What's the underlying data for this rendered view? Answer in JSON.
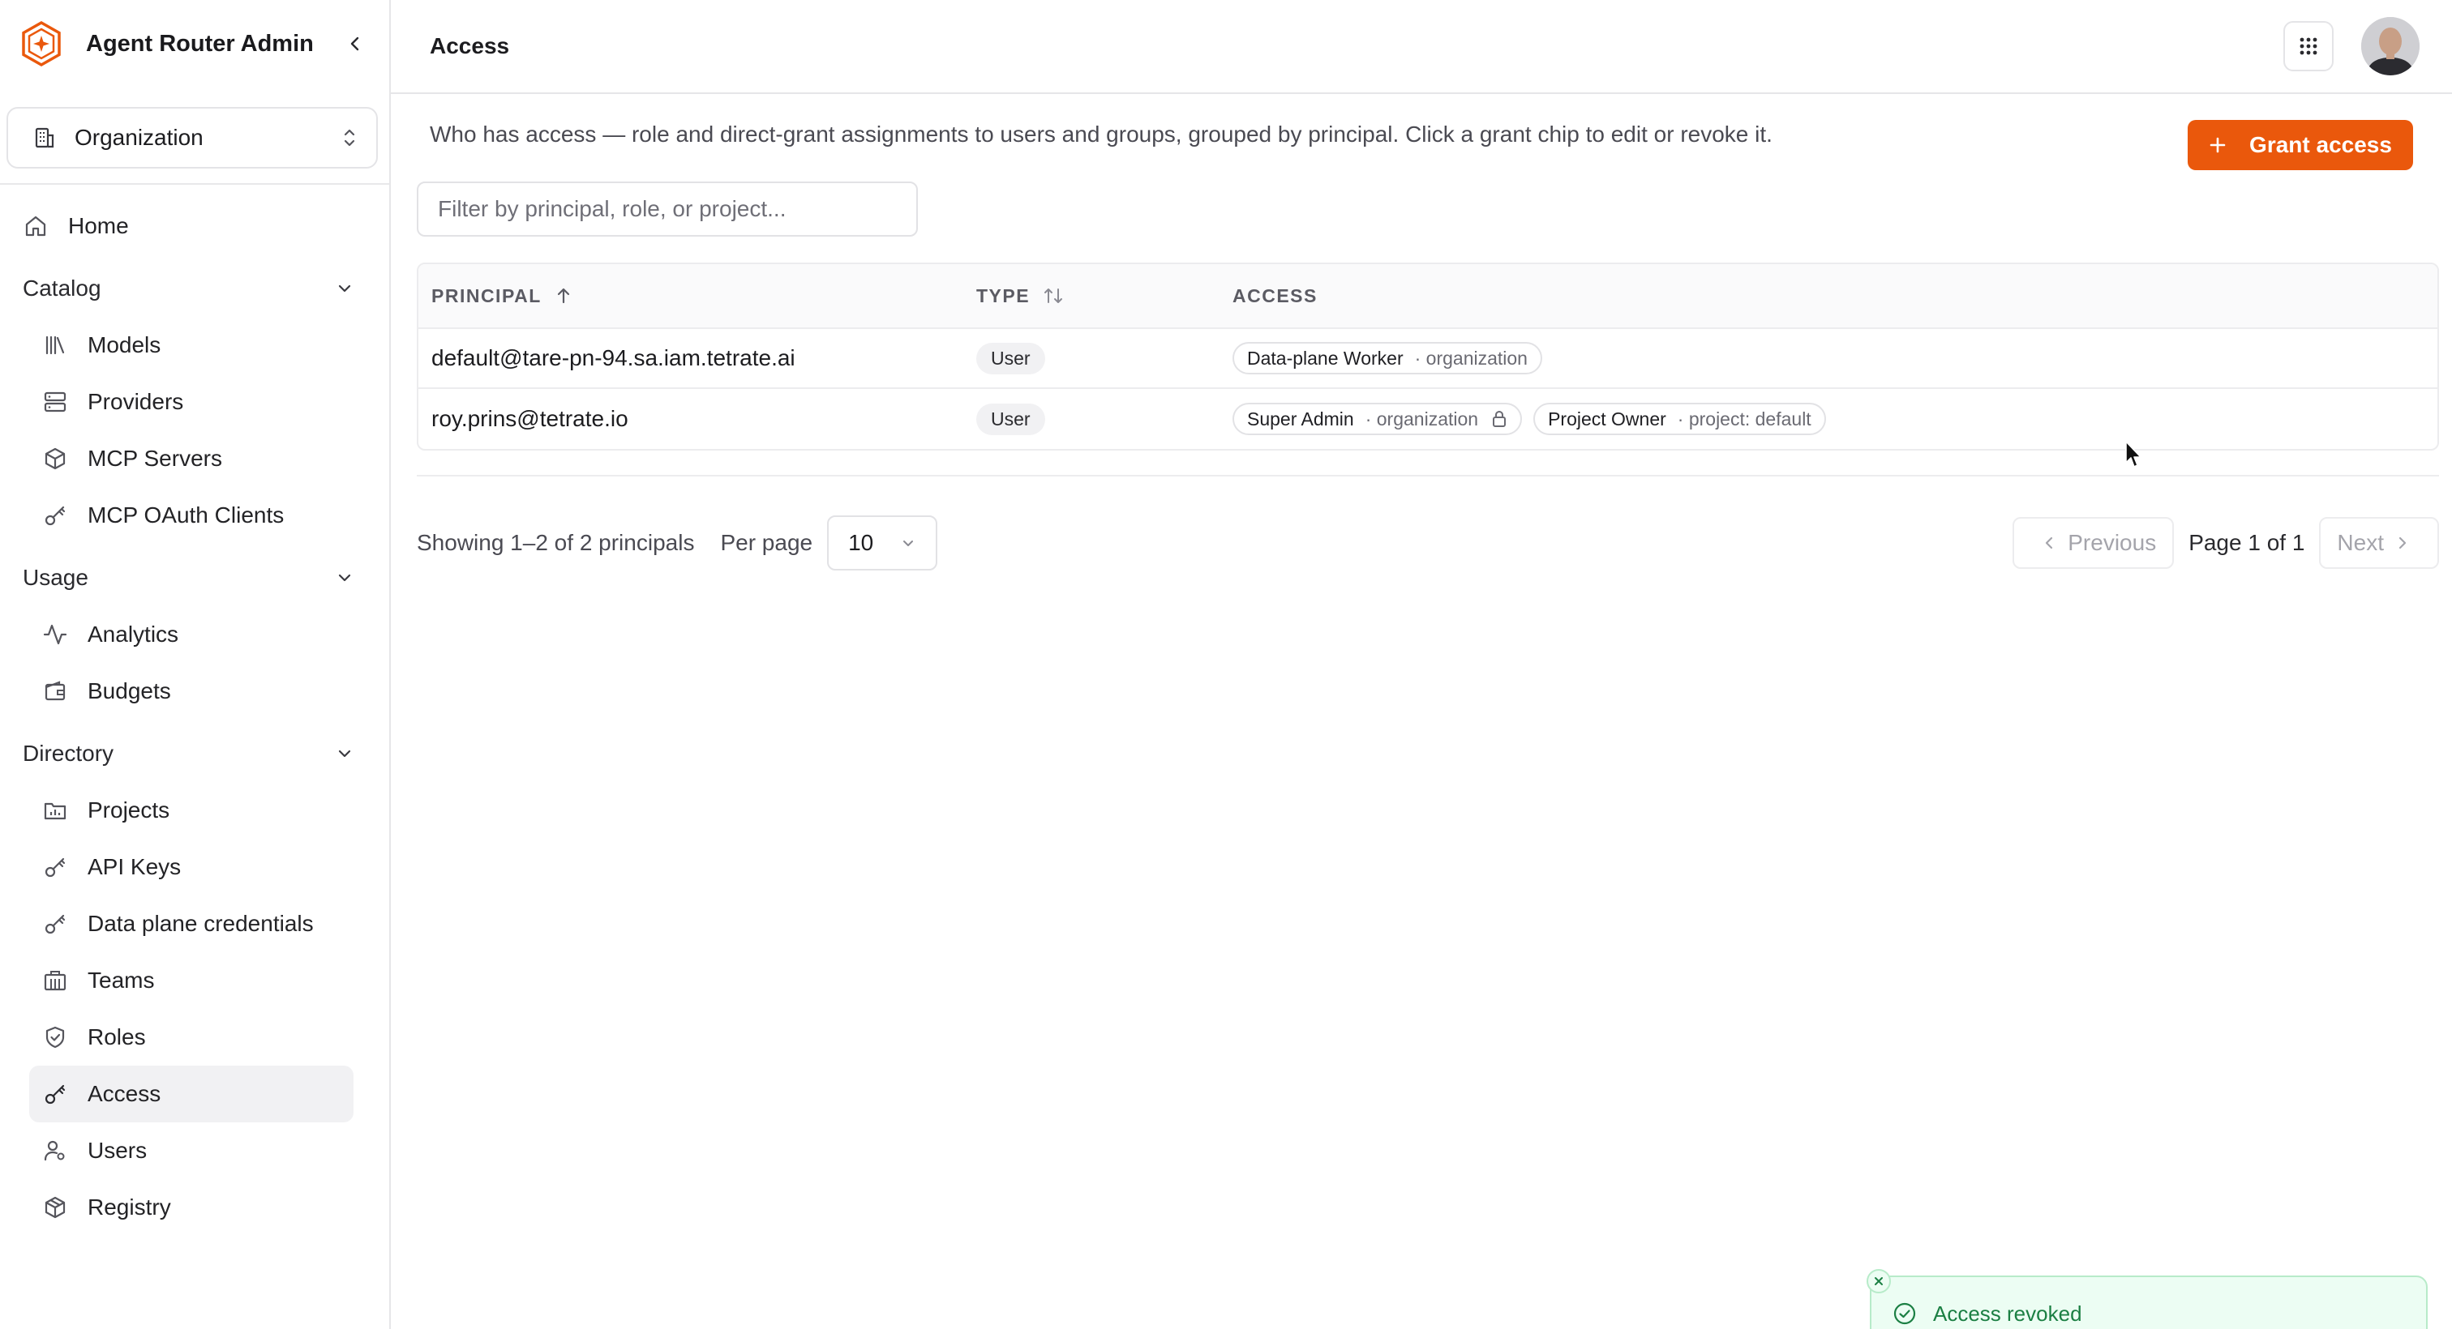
{
  "brand": {
    "title": "Agent Router Admin",
    "accent": "#ea580c"
  },
  "org_switcher": {
    "label": "Organization"
  },
  "nav": {
    "home": "Home",
    "catalog": {
      "label": "Catalog",
      "items": [
        "Models",
        "Providers",
        "MCP Servers",
        "MCP OAuth Clients"
      ]
    },
    "usage": {
      "label": "Usage",
      "items": [
        "Analytics",
        "Budgets"
      ]
    },
    "directory": {
      "label": "Directory",
      "items": [
        "Projects",
        "API Keys",
        "Data plane credentials",
        "Teams",
        "Roles",
        "Access",
        "Users",
        "Registry"
      ]
    },
    "active_item": "Access"
  },
  "header": {
    "title": "Access"
  },
  "main": {
    "description": "Who has access — role and direct-grant assignments to users and groups, grouped by principal. Click a grant chip to edit or revoke it.",
    "grant_button": "Grant access",
    "filter_placeholder": "Filter by principal, role, or project..."
  },
  "table": {
    "columns": [
      "PRINCIPAL",
      "TYPE",
      "ACCESS"
    ],
    "rows": [
      {
        "principal": "default@tare-pn-94.sa.iam.tetrate.ai",
        "type": "User",
        "grants": [
          {
            "role": "Data-plane Worker",
            "scope": "· organization",
            "locked": false
          }
        ]
      },
      {
        "principal": "roy.prins@tetrate.io",
        "type": "User",
        "grants": [
          {
            "role": "Super Admin",
            "scope": "· organization",
            "locked": true
          },
          {
            "role": "Project Owner",
            "scope": "· project: default",
            "locked": false
          }
        ]
      }
    ]
  },
  "pagination": {
    "showing": "Showing 1–2 of 2 principals",
    "per_page_label": "Per page",
    "per_page_value": "10",
    "previous": "Previous",
    "page_info": "Page 1 of 1",
    "next": "Next"
  },
  "toast": {
    "message": "Access revoked",
    "status_color": "#1b7f43"
  }
}
